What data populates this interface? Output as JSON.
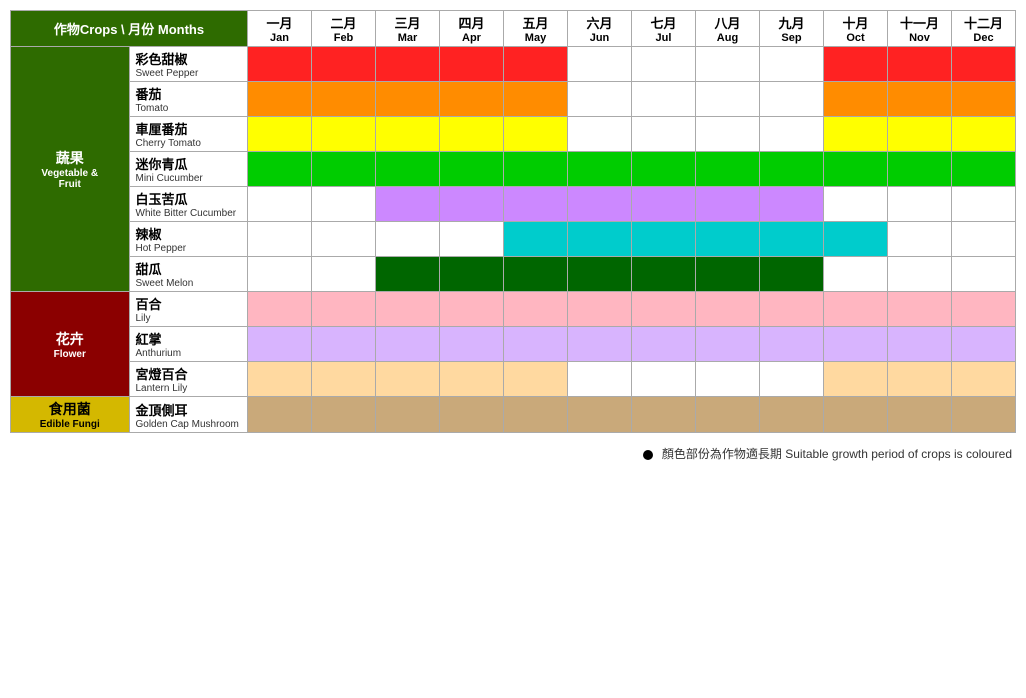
{
  "header": {
    "corner": "作物Crops \\ 月份 Months",
    "months": [
      {
        "zh": "一月",
        "en": "Jan"
      },
      {
        "zh": "二月",
        "en": "Feb"
      },
      {
        "zh": "三月",
        "en": "Mar"
      },
      {
        "zh": "四月",
        "en": "Apr"
      },
      {
        "zh": "五月",
        "en": "May"
      },
      {
        "zh": "六月",
        "en": "Jun"
      },
      {
        "zh": "七月",
        "en": "Jul"
      },
      {
        "zh": "八月",
        "en": "Aug"
      },
      {
        "zh": "九月",
        "en": "Sep"
      },
      {
        "zh": "十月",
        "en": "Oct"
      },
      {
        "zh": "十一月",
        "en": "Nov"
      },
      {
        "zh": "十二月",
        "en": "Dec"
      }
    ]
  },
  "categories": [
    {
      "name_zh": "蔬果",
      "name_en": "Vegetable &\nFruit",
      "class": "cat-veg",
      "rowspan": 7,
      "crops": [
        {
          "name_zh": "彩色甜椒",
          "name_en": "Sweet Pepper",
          "months": [
            "red",
            "red",
            "red",
            "red",
            "red",
            "",
            "",
            "",
            "",
            "red",
            "red",
            "red"
          ]
        },
        {
          "name_zh": "番茄",
          "name_en": "Tomato",
          "months": [
            "orange",
            "orange",
            "orange",
            "orange",
            "orange",
            "",
            "",
            "",
            "",
            "orange",
            "orange",
            "orange"
          ]
        },
        {
          "name_zh": "車厘番茄",
          "name_en": "Cherry Tomato",
          "months": [
            "yellow",
            "yellow",
            "yellow",
            "yellow",
            "yellow",
            "",
            "",
            "",
            "",
            "yellow",
            "yellow",
            "yellow"
          ]
        },
        {
          "name_zh": "迷你青瓜",
          "name_en": "Mini Cucumber",
          "months": [
            "green",
            "green",
            "green",
            "green",
            "green",
            "green",
            "green",
            "green",
            "green",
            "green",
            "green",
            "green"
          ]
        },
        {
          "name_zh": "白玉苦瓜",
          "name_en": "White Bitter Cucumber",
          "months": [
            "",
            "",
            "purple",
            "purple",
            "purple",
            "purple",
            "purple",
            "purple",
            "purple",
            "",
            "",
            ""
          ]
        },
        {
          "name_zh": "辣椒",
          "name_en": "Hot Pepper",
          "months": [
            "",
            "",
            "",
            "",
            "teal",
            "teal",
            "teal",
            "teal",
            "teal",
            "teal",
            "",
            ""
          ]
        },
        {
          "name_zh": "甜瓜",
          "name_en": "Sweet Melon",
          "months": [
            "",
            "",
            "dark-green",
            "dark-green",
            "dark-green",
            "dark-green",
            "dark-green",
            "dark-green",
            "dark-green",
            "",
            "",
            ""
          ]
        }
      ]
    },
    {
      "name_zh": "花卉",
      "name_en": "Flower",
      "class": "cat-flower",
      "rowspan": 3,
      "crops": [
        {
          "name_zh": "百合",
          "name_en": "Lily",
          "months": [
            "pink",
            "pink",
            "pink",
            "pink",
            "pink",
            "pink",
            "pink",
            "pink",
            "pink",
            "pink",
            "pink",
            "pink"
          ]
        },
        {
          "name_zh": "紅掌",
          "name_en": "Anthurium",
          "months": [
            "lavender",
            "lavender",
            "lavender",
            "lavender",
            "lavender",
            "lavender",
            "lavender",
            "lavender",
            "lavender",
            "lavender",
            "lavender",
            "lavender"
          ]
        },
        {
          "name_zh": "宮燈百合",
          "name_en": "Lantern Lily",
          "months": [
            "peach",
            "peach",
            "peach",
            "peach",
            "peach",
            "",
            "",
            "",
            "",
            "peach",
            "peach",
            "peach"
          ]
        }
      ]
    },
    {
      "name_zh": "食用菌",
      "name_en": "Edible Fungi",
      "class": "cat-fungi",
      "rowspan": 1,
      "crops": [
        {
          "name_zh": "金頂側耳",
          "name_en": "Golden Cap Mushroom",
          "months": [
            "tan",
            "tan",
            "tan",
            "tan",
            "tan",
            "tan",
            "tan",
            "tan",
            "tan",
            "tan",
            "tan",
            "tan"
          ]
        }
      ]
    }
  ],
  "legend": {
    "text": "顏色部份為作物適長期  Suitable growth period of crops is coloured"
  }
}
